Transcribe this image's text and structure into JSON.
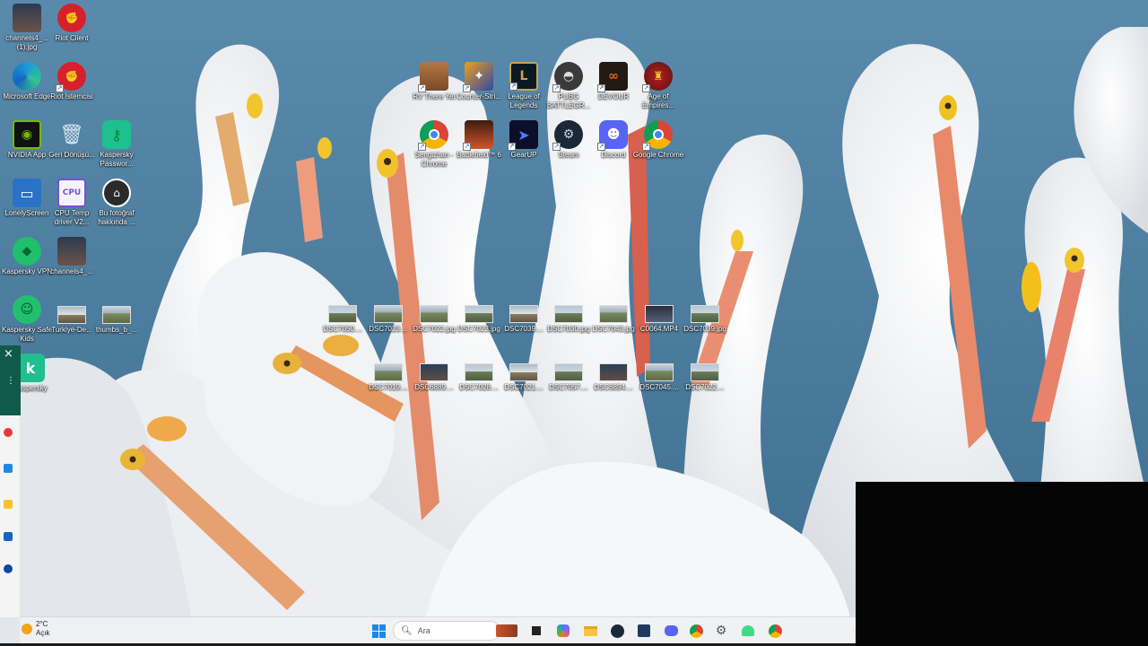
{
  "desktop": {
    "icons_left": [
      {
        "label": "channels4_... (1).jpg",
        "icon": "photo-person-icon"
      },
      {
        "label": "Riot Client",
        "icon": "riot-icon"
      },
      {
        "label": "Microsoft Edge",
        "icon": "edge-icon"
      },
      {
        "label": "Riot İstemcisi",
        "icon": "riot-icon"
      },
      {
        "label": "NVIDIA App",
        "icon": "nvidia-icon"
      },
      {
        "label": "Geri Dönüşü...",
        "icon": "recycle-bin-icon"
      },
      {
        "label": "Kaspersky Passwor...",
        "icon": "kaspersky-password-icon"
      },
      {
        "label": "LonelyScreen",
        "icon": "monitor-icon"
      },
      {
        "label": "CPU Temp driver V2...",
        "icon": "cpu-icon"
      },
      {
        "label": "Bu fotoğraf hakkında ...",
        "icon": "info-icon"
      },
      {
        "label": "Kaspersky VPN",
        "icon": "kaspersky-vpn-icon"
      },
      {
        "label": "channels4_...",
        "icon": "photo-person-icon"
      },
      {
        "label": "Kaspersky Safe Kids",
        "icon": "kaspersky-safekids-icon"
      },
      {
        "label": "Turkiye-De...",
        "icon": "photo-icon"
      },
      {
        "label": "thumbs_b_...",
        "icon": "photo-icon"
      },
      {
        "label": "Kaspersky",
        "icon": "kaspersky-icon"
      }
    ],
    "icons_games": [
      {
        "label": "RV There Yet",
        "icon": "rv-game-icon"
      },
      {
        "label": "Counter-Stri...",
        "icon": "counter-strike-icon"
      },
      {
        "label": "League of Legends",
        "icon": "league-icon"
      },
      {
        "label": "PUBG BATTLEGR...",
        "icon": "pubg-icon"
      },
      {
        "label": "DEVOUR",
        "icon": "devour-icon"
      },
      {
        "label": "Age of Empires...",
        "icon": "age-of-empires-icon"
      },
      {
        "label": "Sengizhan - Chrome",
        "icon": "chrome-icon"
      },
      {
        "label": "Battlefield™ 6",
        "icon": "battlefield-icon"
      },
      {
        "label": "GearUP",
        "icon": "gearup-icon"
      },
      {
        "label": "Steam",
        "icon": "steam-icon"
      },
      {
        "label": "Discord",
        "icon": "discord-icon"
      },
      {
        "label": "Google Chrome",
        "icon": "chrome-icon"
      }
    ],
    "files_row1": [
      "DSC7050....",
      "DSC7023....",
      "DSC7022.jpg",
      "DSC7023.jpg",
      "DSC7039....",
      "DSC7030.jpg",
      "DSC7043.jpg",
      "C0064.MP4",
      "DSC7039.jpg"
    ],
    "files_row2": [
      "DSC7019....",
      "DSC6889....",
      "DSC7028....",
      "DSC7021....",
      "DSC7057....",
      "DSC6894....",
      "DSC7045....",
      "DSC7022...."
    ]
  },
  "taskbar": {
    "weather_temp": "2°C",
    "weather_desc": "Açık",
    "search_placeholder": "Ara"
  },
  "colors": {
    "water": "#4d7f9f",
    "taskbar": "#eef0f3",
    "side_strip": "#0f5a4a"
  }
}
